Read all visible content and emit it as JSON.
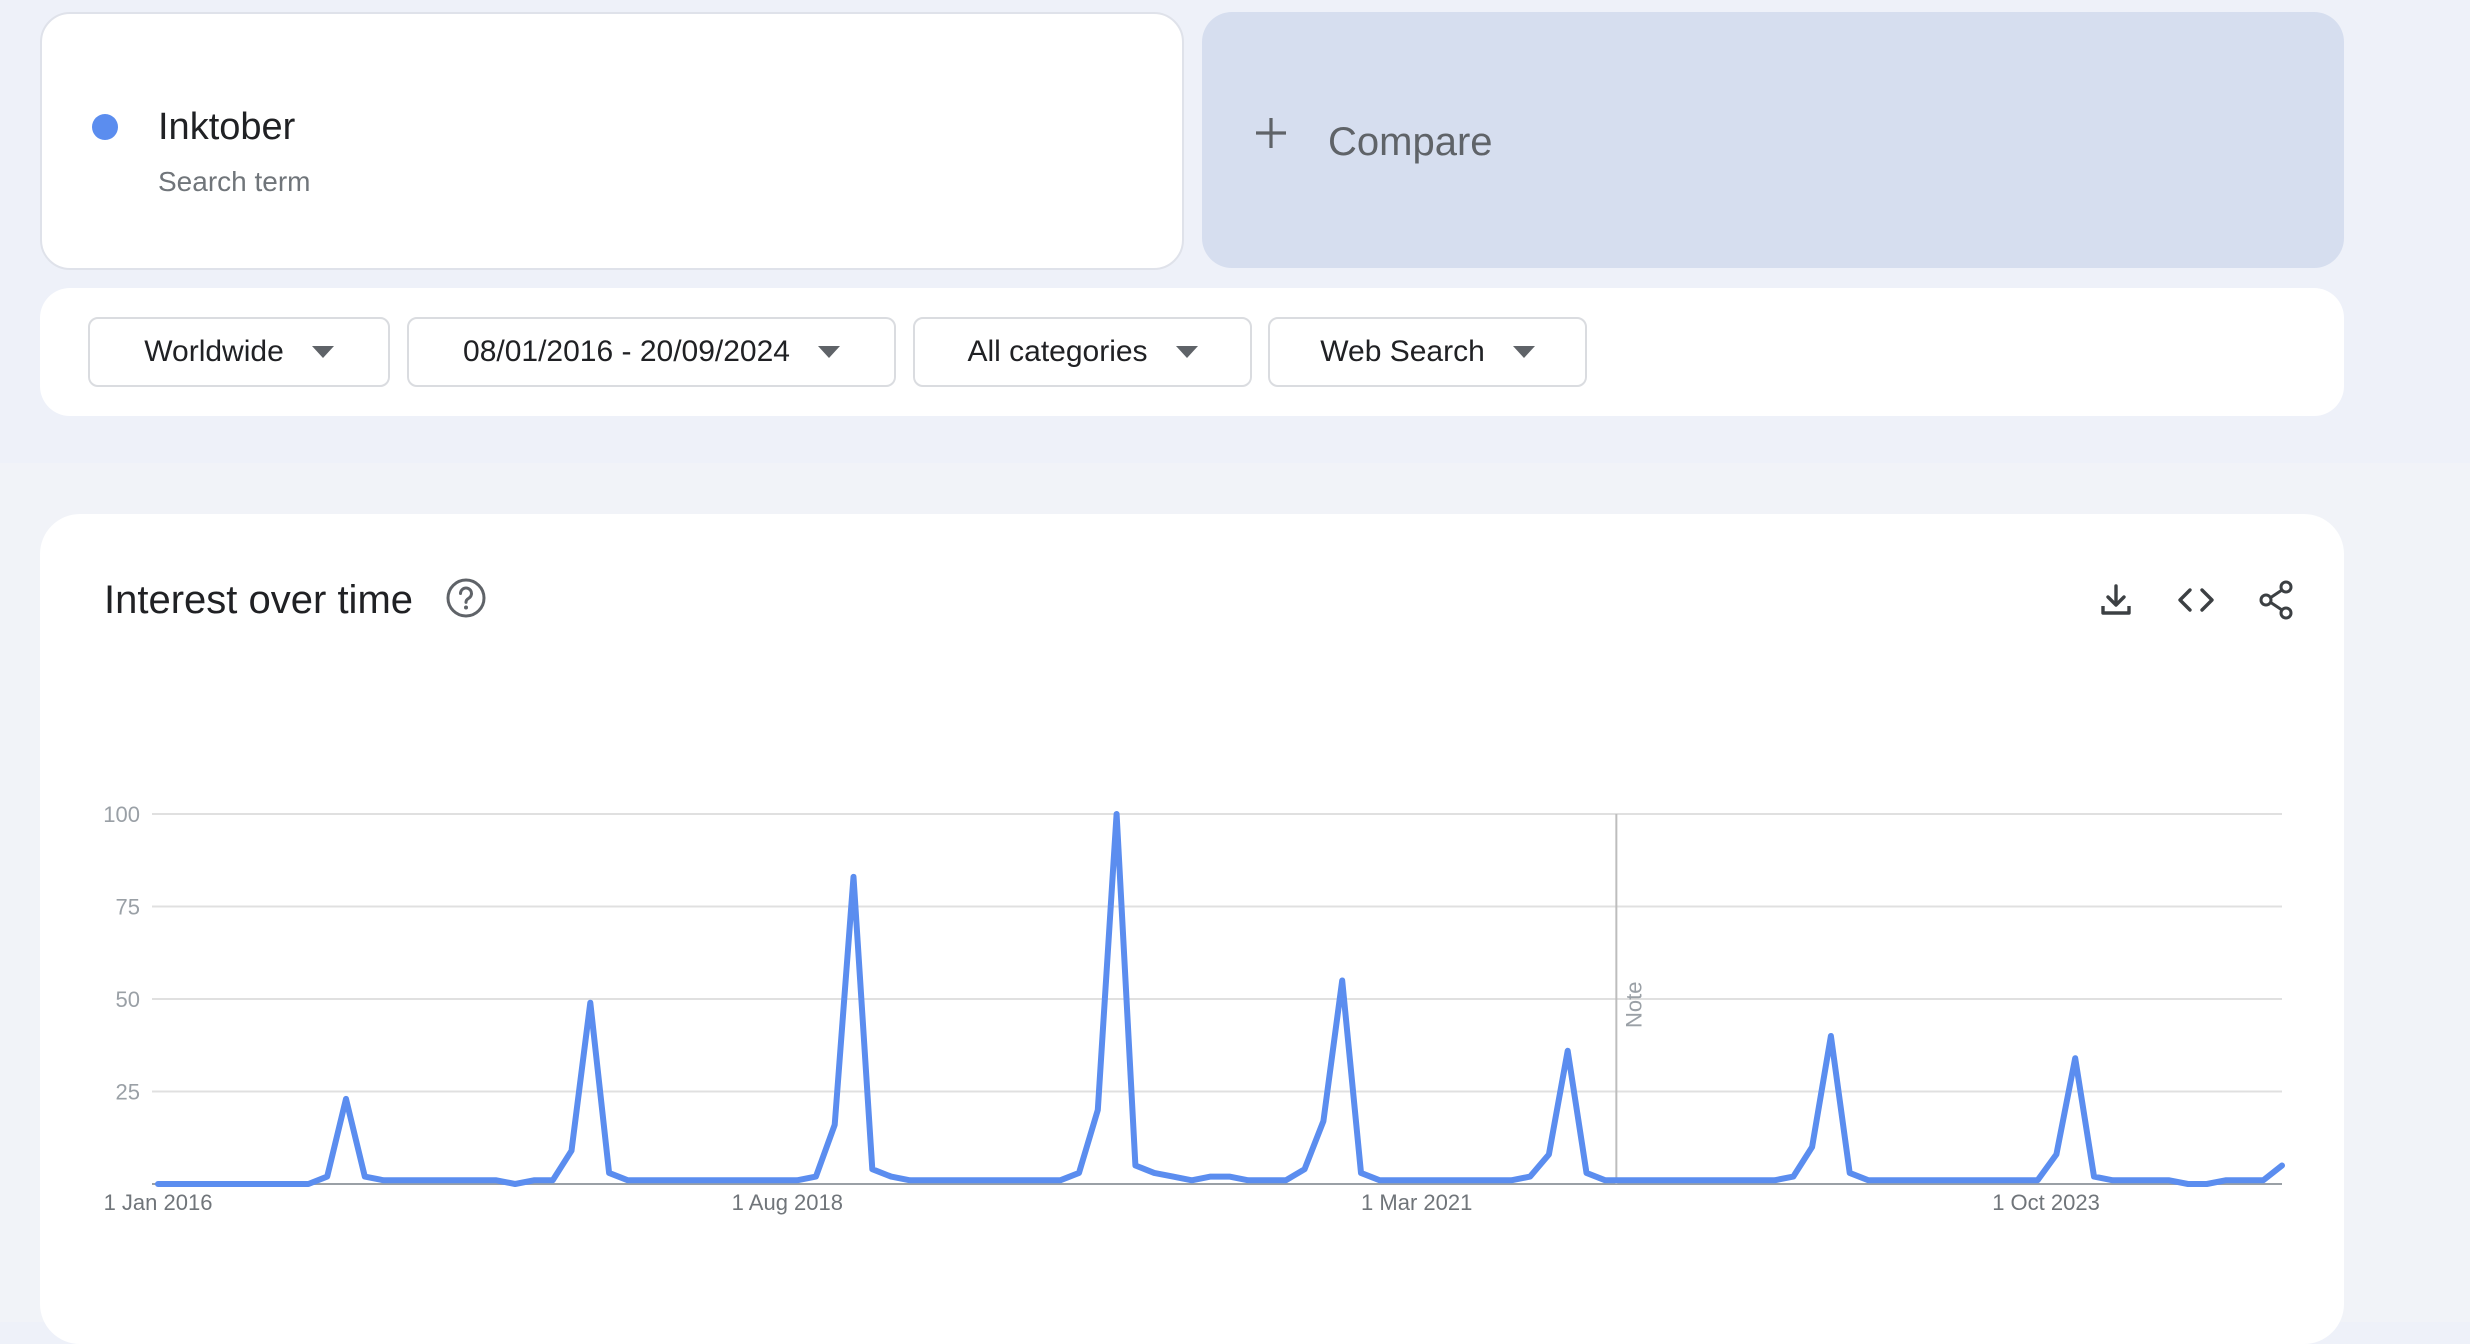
{
  "term": {
    "name": "Inktober",
    "subtitle": "Search term",
    "color": "#5b8def"
  },
  "compare": {
    "label": "Compare",
    "icon": "plus-icon"
  },
  "filters": {
    "region": "Worldwide",
    "date_range": "08/01/2016 - 20/09/2024",
    "category": "All categories",
    "search_type": "Web Search"
  },
  "chart": {
    "title": "Interest over time",
    "help_icon": "help-circle-icon",
    "toolbar": {
      "download": "download-icon",
      "embed": "code-icon",
      "share": "share-icon"
    },
    "note_label": "Note"
  },
  "chart_data": {
    "type": "line",
    "title": "Interest over time",
    "xlabel": "",
    "ylabel": "",
    "ylim": [
      0,
      100
    ],
    "yticks": [
      100,
      75,
      50,
      25
    ],
    "x_tick_labels": [
      "1 Jan 2016",
      "1 Aug 2018",
      "1 Mar 2021",
      "1 Oct 2023"
    ],
    "grid": true,
    "series": [
      {
        "color": "#5b8def",
        "values": [
          0,
          0,
          0,
          0,
          0,
          0,
          0,
          0,
          0,
          2,
          23,
          2,
          1,
          1,
          1,
          1,
          1,
          1,
          1,
          0,
          1,
          1,
          9,
          49,
          3,
          1,
          1,
          1,
          1,
          1,
          1,
          1,
          1,
          1,
          1,
          2,
          16,
          83,
          4,
          2,
          1,
          1,
          1,
          1,
          1,
          1,
          1,
          1,
          1,
          3,
          20,
          100,
          5,
          3,
          2,
          1,
          2,
          2,
          1,
          1,
          1,
          4,
          17,
          55,
          3,
          1,
          1,
          1,
          1,
          1,
          1,
          1,
          1,
          2,
          8,
          36,
          3,
          1,
          1,
          1,
          1,
          1,
          1,
          1,
          1,
          1,
          1,
          2,
          10,
          40,
          3,
          1,
          1,
          1,
          1,
          1,
          1,
          1,
          1,
          1,
          1,
          8,
          34,
          2,
          1,
          1,
          1,
          1,
          0,
          0,
          1,
          1,
          1,
          5
        ]
      }
    ],
    "annotations": [
      {
        "label": "Note",
        "x_fraction": 0.6866
      }
    ]
  }
}
